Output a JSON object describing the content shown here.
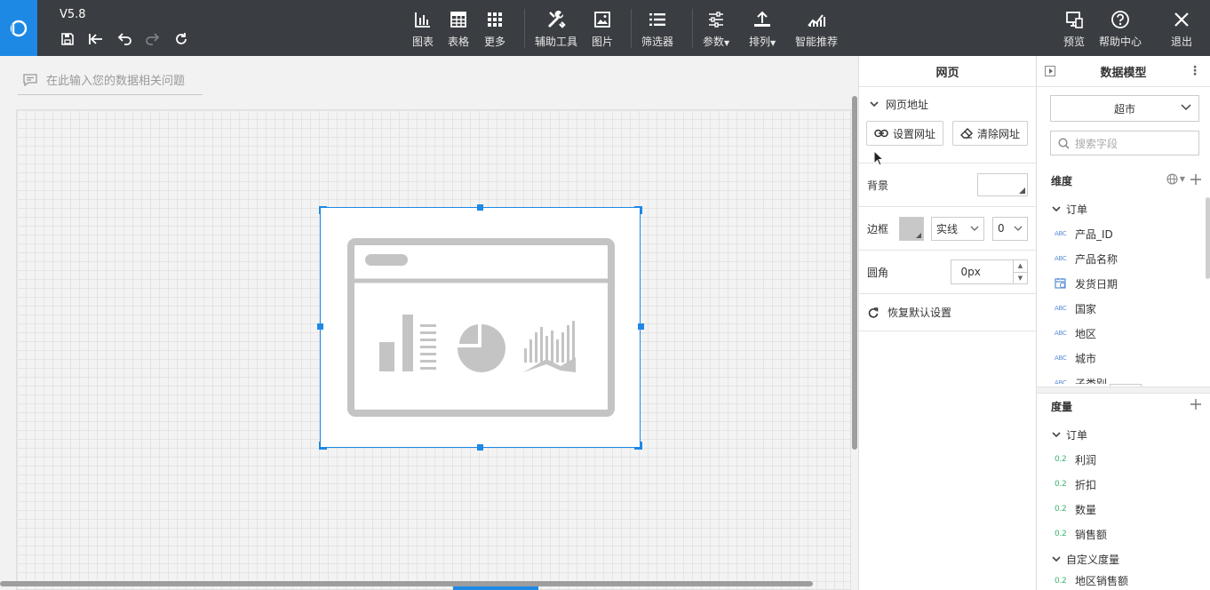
{
  "app": {
    "version": "V5.8"
  },
  "toolbar": {
    "center": [
      {
        "label": "图表",
        "icon": "bar-chart-icon"
      },
      {
        "label": "表格",
        "icon": "table-icon"
      },
      {
        "label": "更多",
        "icon": "grid-dots-icon"
      },
      {
        "label": "辅助工具",
        "icon": "tools-icon"
      },
      {
        "label": "图片",
        "icon": "image-icon"
      },
      {
        "label": "筛选器",
        "icon": "filter-list-icon"
      },
      {
        "label": "参数",
        "icon": "sliders-icon"
      },
      {
        "label": "排列",
        "icon": "arrange-icon"
      },
      {
        "label": "智能推荐",
        "icon": "smart-chart-icon"
      }
    ],
    "right": [
      {
        "label": "预览",
        "icon": "preview-icon"
      },
      {
        "label": "帮助中心",
        "icon": "help-icon"
      },
      {
        "label": "退出",
        "icon": "close-icon"
      }
    ]
  },
  "canvas": {
    "ask_placeholder": "在此输入您的数据相关问题"
  },
  "props": {
    "title": "网页",
    "url_section": "网页地址",
    "set_url": "设置网址",
    "clear_url": "清除网址",
    "background_label": "背景",
    "border_label": "边框",
    "border_style": "实线",
    "border_width": "0",
    "radius_label": "圆角",
    "radius_value": "0px",
    "reset": "恢复默认设置"
  },
  "model": {
    "title": "数据模型",
    "dataset": "超市",
    "search_placeholder": "搜索字段",
    "dimensions_label": "维度",
    "dim_folder": "订单",
    "dimensions": [
      {
        "type": "ABC",
        "name": "产品_ID"
      },
      {
        "type": "ABC",
        "name": "产品名称"
      },
      {
        "type": "date",
        "name": "发货日期"
      },
      {
        "type": "ABC",
        "name": "国家"
      },
      {
        "type": "ABC",
        "name": "地区"
      },
      {
        "type": "ABC",
        "name": "城市"
      },
      {
        "type": "ABC",
        "name": "子类别"
      }
    ],
    "measures_label": "度量",
    "meas_folder": "订单",
    "measures": [
      {
        "type": "0.2",
        "name": "利润"
      },
      {
        "type": "0.2",
        "name": "折扣"
      },
      {
        "type": "0.2",
        "name": "数量"
      },
      {
        "type": "0.2",
        "name": "销售额"
      }
    ],
    "custom_folder": "自定义度量",
    "custom_measures": [
      {
        "type": "0.2",
        "name": "地区销售额"
      }
    ]
  }
}
